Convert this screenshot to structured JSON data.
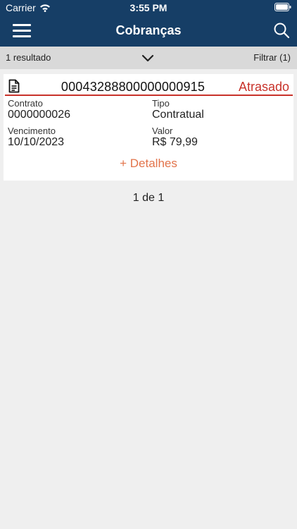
{
  "status_bar": {
    "carrier": "Carrier",
    "time": "3:55 PM"
  },
  "header": {
    "title": "Cobranças",
    "background_color": "#163e66"
  },
  "filter_bar": {
    "result_count": "1 resultado",
    "filter_label": "Filtrar (1)"
  },
  "card": {
    "number": "00043288800000000915",
    "status": "Atrasado",
    "status_color": "#c8322a",
    "fields": {
      "contract_label": "Contrato",
      "contract_value": "0000000026",
      "type_label": "Tipo",
      "type_value": "Contratual",
      "due_label": "Vencimento",
      "due_value": "10/10/2023",
      "amount_label": "Valor",
      "amount_value": "R$ 79,99"
    },
    "details_label": "+ Detalhes",
    "details_color": "#e2734a"
  },
  "pagination": {
    "text": "1 de 1"
  },
  "icons": [
    "wifi-icon",
    "battery-icon",
    "menu-icon",
    "search-icon",
    "chevron-down-icon",
    "document-icon"
  ]
}
